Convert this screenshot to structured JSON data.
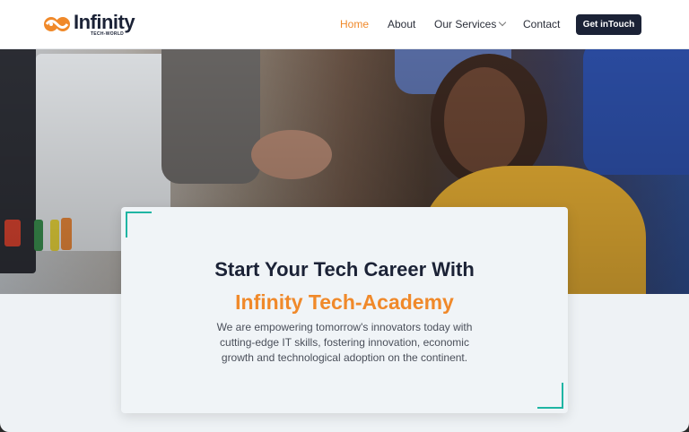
{
  "brand": {
    "name": "Infinity",
    "tagline": "TECH-WORLD",
    "accent": "#f0892a",
    "dark": "#1b2236"
  },
  "nav": {
    "items": [
      {
        "label": "Home",
        "active": true
      },
      {
        "label": "About",
        "active": false
      },
      {
        "label": "Our Services",
        "active": false,
        "dropdown": true
      },
      {
        "label": "Contact",
        "active": false
      }
    ],
    "cta": "Get inTouch"
  },
  "hero": {
    "image_icon": "hero-photo-students-at-computer",
    "title_line1": "Start Your Tech Career With",
    "title_line2": "Infinity Tech-Academy",
    "description": "We are empowering tomorrow's innovators today with cutting-edge IT skills, fostering innovation, economic growth and technological adoption on the continent.",
    "corner_color": "#1fb5a3"
  }
}
